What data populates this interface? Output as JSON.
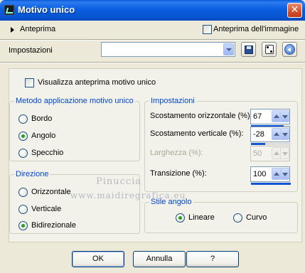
{
  "window": {
    "title": "Motivo unico",
    "close_glyph": "✕"
  },
  "preview": {
    "label": "Anteprima",
    "image_checkbox_label": "Anteprima dell'immagine",
    "image_checkbox_checked": false
  },
  "presets": {
    "label": "Impostazioni",
    "value": "",
    "icons": [
      "save-icon",
      "dice-icon",
      "reset-icon"
    ]
  },
  "panel": {
    "preview_checkbox_label": "Visualizza anteprima motivo unico",
    "preview_checkbox_checked": false,
    "method": {
      "legend": "Metodo applicazione motivo unico",
      "options": [
        "Bordo",
        "Angolo",
        "Specchio"
      ],
      "selected": "Angolo"
    },
    "direction": {
      "legend": "Direzione",
      "options": [
        "Orizzontale",
        "Verticale",
        "Bidirezionale"
      ],
      "selected": "Bidirezionale"
    },
    "settings": {
      "legend": "Impostazioni",
      "rows": [
        {
          "label": "Scostamento orizzontale (%):",
          "value": "67",
          "enabled": true,
          "fill": 0.83
        },
        {
          "label": "Scostamento verticale (%):",
          "value": "-28",
          "enabled": true,
          "fill": 0.36
        },
        {
          "label": "Larghezza (%):",
          "value": "50",
          "enabled": false,
          "fill": 0.5
        },
        {
          "label": "Transizione (%):",
          "value": "100",
          "enabled": true,
          "fill": 1.0
        }
      ]
    },
    "corner_style": {
      "legend": "Stile angolo",
      "options": [
        "Lineare",
        "Curvo"
      ],
      "selected": "Lineare"
    },
    "watermark": [
      "Pinuccia",
      "www.maidiregrafica.eu"
    ]
  },
  "buttons": {
    "ok": "OK",
    "cancel": "Annulla",
    "help": "?"
  },
  "colors": {
    "accent": "#0046d5",
    "title_bar": "#0a5fe0",
    "radio_selected": "#21a121",
    "slider_fill": "#1256d6"
  }
}
